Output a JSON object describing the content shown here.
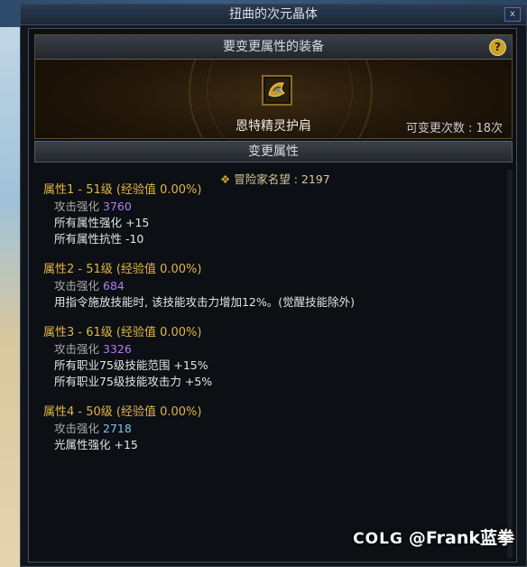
{
  "window": {
    "title": "扭曲的次元晶体",
    "close_label": "x"
  },
  "equip_panel": {
    "header": "要变更属性的装备",
    "help_label": "?",
    "item_name": "恩特精灵护肩",
    "change_count": "可变更次数 : 18次"
  },
  "attr_section": {
    "header": "变更属性",
    "adventurer": "冒险家名望 : 2197",
    "groups": [
      {
        "title": "属性1 - 51级 (经验值 0.00%)",
        "lines": [
          {
            "label": "攻击强化",
            "value": "3760"
          },
          {
            "text": "所有属性强化 +15"
          },
          {
            "text": "所有属性抗性 -10"
          }
        ]
      },
      {
        "title": "属性2 - 51级 (经验值 0.00%)",
        "lines": [
          {
            "label": "攻击强化",
            "value": "684"
          },
          {
            "text": "用指令施放技能时, 该技能攻击力增加12%。(觉醒技能除外)"
          }
        ]
      },
      {
        "title": "属性3 - 61级 (经验值 0.00%)",
        "lines": [
          {
            "label": "攻击强化",
            "value": "3326"
          },
          {
            "text": "所有职业75级技能范围 +15%"
          },
          {
            "text": "所有职业75级技能攻击力 +5%"
          }
        ]
      },
      {
        "title": "属性4 - 50级 (经验值 0.00%)",
        "lines": [
          {
            "label": "攻击强化",
            "value": "2718"
          },
          {
            "text": "光属性强化 +15"
          }
        ]
      }
    ]
  },
  "watermark": {
    "logo": "COLG",
    "text": "@Frank蓝拳"
  },
  "colors": {
    "title_gold": "#e0b44a",
    "value_purple": "#b17cf0",
    "value_cyan": "#7cc6f0"
  },
  "icons": {
    "help": "help-icon",
    "item": "shoulder-armor-icon",
    "adventurer": "medal-icon"
  }
}
